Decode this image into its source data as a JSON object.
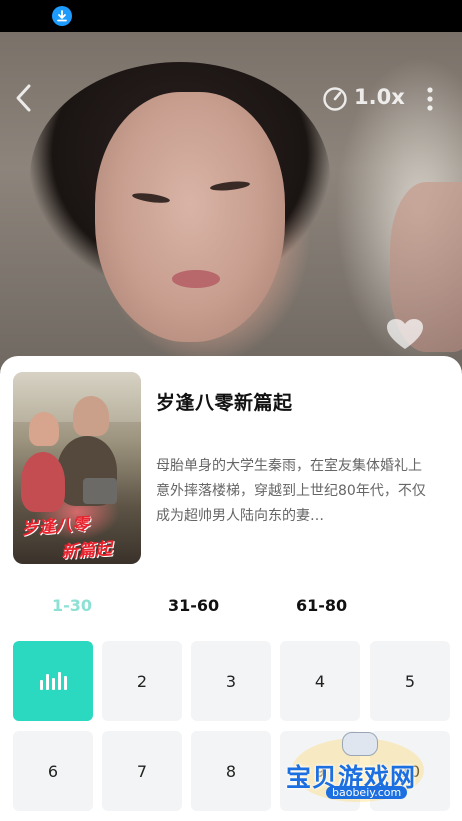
{
  "video": {
    "speed_label": "1.0x",
    "like_label": "点赞"
  },
  "drama": {
    "title": "岁逢八零新篇起",
    "description": "母胎单身的大学生秦雨，在室友集体婚礼上意外摔落楼梯，穿越到上世纪80年代，不仅成为超帅男人陆向东的妻…",
    "cover_line1": "岁逢八零",
    "cover_line2": "新篇起"
  },
  "tabs": [
    {
      "label": "1-30",
      "active": true
    },
    {
      "label": "31-60",
      "active": false
    },
    {
      "label": "61-80",
      "active": false
    }
  ],
  "episodes": [
    "",
    "2",
    "3",
    "4",
    "5",
    "6",
    "7",
    "8",
    "9",
    "10"
  ],
  "watermark": {
    "text": "宝贝游戏网",
    "url": "baobeiy.com"
  },
  "colors": {
    "accent": "#2bd9c0",
    "active_tab": "#8de0d4",
    "status_download": "#1e9bff"
  },
  "icons": [
    "download-icon",
    "back-arrow-icon",
    "speed-icon",
    "more-icon",
    "heart-icon",
    "equalizer-icon"
  ]
}
